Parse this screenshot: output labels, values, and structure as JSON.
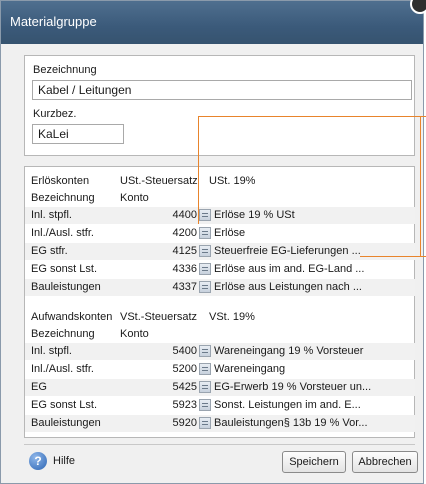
{
  "window": {
    "title": "Materialgruppe"
  },
  "fields": {
    "bezeichnung_label": "Bezeichnung",
    "bezeichnung_value": "Kabel / Leitungen",
    "kurzbez_label": "Kurzbez.",
    "kurzbez_value": "KaLei"
  },
  "erloes": {
    "header": [
      "Erlöskonten",
      "USt.-Steuersatz",
      "USt. 19%"
    ],
    "subheader": [
      "Bezeichnung",
      "Konto"
    ],
    "rows": [
      {
        "label": "Inl. stpfl.",
        "account": "4400",
        "desc": "Erlöse 19 % USt"
      },
      {
        "label": "Inl./Ausl. stfr.",
        "account": "4200",
        "desc": "Erlöse"
      },
      {
        "label": "EG stfr.",
        "account": "4125",
        "desc": "Steuerfreie EG-Lieferungen ..."
      },
      {
        "label": "EG sonst Lst.",
        "account": "4336",
        "desc": "Erlöse aus im and. EG-Land ..."
      },
      {
        "label": "Bauleistungen",
        "account": "4337",
        "desc": "Erlöse aus Leistungen nach ..."
      }
    ]
  },
  "aufwand": {
    "header": [
      "Aufwandskonten",
      "VSt.-Steuersatz",
      "VSt. 19%"
    ],
    "subheader": [
      "Bezeichnung",
      "Konto"
    ],
    "rows": [
      {
        "label": "Inl. stpfl.",
        "account": "5400",
        "desc": "Wareneingang 19 % Vorsteuer"
      },
      {
        "label": "Inl./Ausl. stfr.",
        "account": "5200",
        "desc": "Wareneingang"
      },
      {
        "label": "EG",
        "account": "5425",
        "desc": "EG-Erwerb 19 % Vorsteuer un..."
      },
      {
        "label": "EG sonst Lst.",
        "account": "5923",
        "desc": "Sonst. Leistungen im and. E..."
      },
      {
        "label": "Bauleistungen",
        "account": "5920",
        "desc": "Bauleistungen§ 13b 19 % Vor..."
      }
    ]
  },
  "footer": {
    "help": "Hilfe",
    "save": "Speichern",
    "cancel": "Abbrechen"
  },
  "colors": {
    "titlebar": "#3b5a7a",
    "callout": "#e8842c"
  },
  "icons": {
    "help": "help-icon",
    "picker": "account-picker-icon"
  }
}
